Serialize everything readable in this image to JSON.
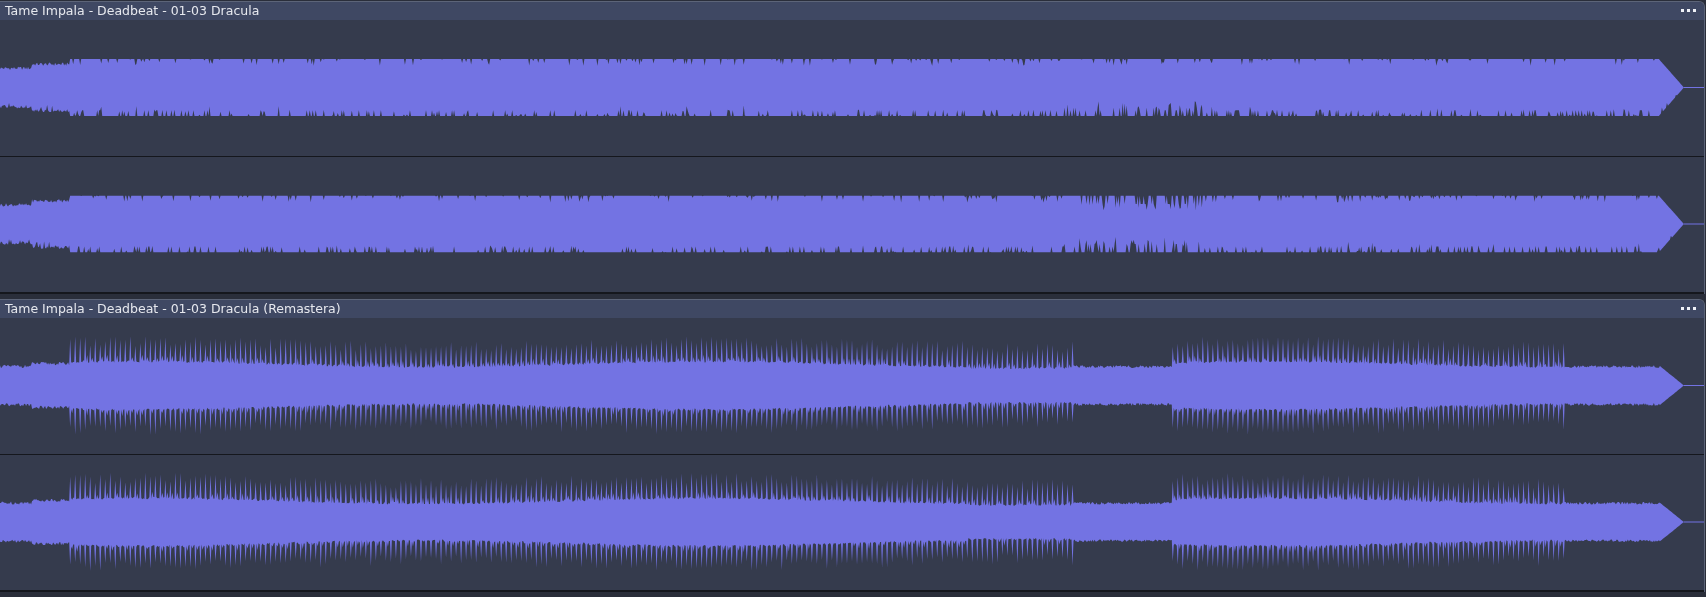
{
  "tracks": [
    {
      "title": "Tame Impala - Deadbeat - 01-03 Dracula",
      "kind": "compressed"
    },
    {
      "title": "Tame Impala - Deadbeat - 01-03 Dracula (Remastera)",
      "kind": "dynamic"
    }
  ]
}
